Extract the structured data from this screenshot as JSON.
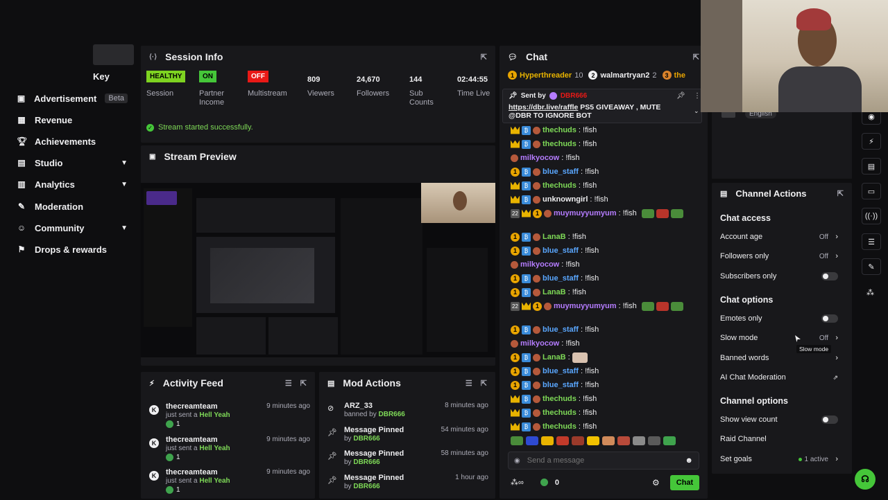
{
  "nav": {
    "items": [
      {
        "label": "Key",
        "icon": "key-icon"
      },
      {
        "label": "Advertisement",
        "icon": "ad-icon",
        "badge": "Beta"
      },
      {
        "label": "Revenue",
        "icon": "revenue-icon"
      },
      {
        "label": "Achievements",
        "icon": "trophy-icon"
      },
      {
        "label": "Studio",
        "icon": "studio-icon",
        "expandable": true
      },
      {
        "label": "Analytics",
        "icon": "analytics-icon",
        "expandable": true
      },
      {
        "label": "Moderation",
        "icon": "wrench-icon"
      },
      {
        "label": "Community",
        "icon": "community-icon",
        "expandable": true
      },
      {
        "label": "Drops & rewards",
        "icon": "drops-icon"
      }
    ]
  },
  "session": {
    "title": "Session Info",
    "stats": [
      {
        "value": "HEALTHY",
        "label": "Session",
        "badge_color": "#7ed321"
      },
      {
        "value": "ON",
        "label": "Partner Income",
        "badge_color": "#45c639"
      },
      {
        "value": "OFF",
        "label": "Multistream",
        "badge_color": "#e91916"
      },
      {
        "value": "809",
        "label": "Viewers"
      },
      {
        "value": "24,670",
        "label": "Followers"
      },
      {
        "value": "144",
        "label": "Sub Counts"
      },
      {
        "value": "02:44:55",
        "label": "Time Live"
      }
    ],
    "status": "Stream started successfully."
  },
  "preview": {
    "title": "Stream Preview"
  },
  "activity": {
    "title": "Activity Feed",
    "items": [
      {
        "name": "thecreamteam",
        "action": "just sent a",
        "item": "Hell Yeah",
        "time": "9 minutes ago",
        "count": "1"
      },
      {
        "name": "thecreamteam",
        "action": "just sent a",
        "item": "Hell Yeah",
        "time": "9 minutes ago",
        "count": "1"
      },
      {
        "name": "thecreamteam",
        "action": "just sent a",
        "item": "Hell Yeah",
        "time": "9 minutes ago",
        "count": "1"
      }
    ]
  },
  "mod": {
    "title": "Mod Actions",
    "items": [
      {
        "name": "ARZ_33",
        "action": "banned by",
        "by": "DBR666",
        "time": "8 minutes ago",
        "icon": "ban-icon"
      },
      {
        "name": "Message Pinned",
        "action": "by",
        "by": "DBR666",
        "time": "54 minutes ago",
        "icon": "pin-icon"
      },
      {
        "name": "Message Pinned",
        "action": "by",
        "by": "DBR666",
        "time": "58 minutes ago",
        "icon": "pin-icon"
      },
      {
        "name": "Message Pinned",
        "action": "by",
        "by": "DBR666",
        "time": "1 hour ago",
        "icon": "pin-icon"
      }
    ]
  },
  "chat": {
    "title": "Chat",
    "leaders": [
      {
        "name": "Hyperthreader",
        "count": "10"
      },
      {
        "name": "walmartryan2",
        "count": "2"
      },
      {
        "name": "the",
        "count": ""
      }
    ],
    "pinned": {
      "sent_by": "Sent by",
      "sender": "DBR666",
      "link": "https://dbr.live/raffle",
      "text": "PS5 GIVEAWAY , MUTE @DBR TO IGNORE BOT"
    },
    "messages": [
      {
        "user": "thechuds",
        "text": ": !fish",
        "color": "#7ed957"
      },
      {
        "user": "thechuds",
        "text": ": !fish",
        "color": "#7ed957"
      },
      {
        "user": "milkyocow",
        "text": ": !fish",
        "color": "#b57cff"
      },
      {
        "user": "blue_staff",
        "text": ": !fish",
        "color": "#5aa7ff"
      },
      {
        "user": "thechuds",
        "text": ": !fish",
        "color": "#7ed957"
      },
      {
        "user": "unknowngirl",
        "text": ": !fish",
        "color": "#efeff1"
      },
      {
        "user": "muymuyyumyum",
        "text": ": !fish",
        "color": "#b57cff"
      },
      {
        "user": "LanaB",
        "text": ": !fish",
        "color": "#7ed957"
      },
      {
        "user": "blue_staff",
        "text": ": !fish",
        "color": "#5aa7ff"
      },
      {
        "user": "milkyocow",
        "text": ": !fish",
        "color": "#b57cff"
      },
      {
        "user": "blue_staff",
        "text": ": !fish",
        "color": "#5aa7ff"
      },
      {
        "user": "LanaB",
        "text": ": !fish",
        "color": "#7ed957"
      },
      {
        "user": "muymuyyumyum",
        "text": ": !fish",
        "color": "#b57cff"
      },
      {
        "user": "blue_staff",
        "text": ": !fish",
        "color": "#5aa7ff"
      },
      {
        "user": "milkyocow",
        "text": ": !fish",
        "color": "#b57cff"
      },
      {
        "user": "LanaB",
        "text": ":",
        "color": "#7ed957"
      },
      {
        "user": "blue_staff",
        "text": ": !fish",
        "color": "#5aa7ff"
      },
      {
        "user": "blue_staff",
        "text": ": !fish",
        "color": "#5aa7ff"
      },
      {
        "user": "thechuds",
        "text": ": !fish",
        "color": "#7ed957"
      },
      {
        "user": "thechuds",
        "text": ": !fish",
        "color": "#7ed957"
      },
      {
        "user": "thechuds",
        "text": ": !fish",
        "color": "#7ed957"
      }
    ],
    "placeholder": "Send a message",
    "points": "0",
    "send_label": "Chat"
  },
  "channel_actions": {
    "language": "English",
    "title": "Channel Actions",
    "chat_access": "Chat access",
    "account_age": {
      "label": "Account age",
      "value": "Off"
    },
    "followers_only": {
      "label": "Followers only",
      "value": "Off"
    },
    "subscribers_only": {
      "label": "Subscribers only"
    },
    "chat_options": "Chat options",
    "emotes_only": {
      "label": "Emotes only"
    },
    "slow_mode": {
      "label": "Slow mode",
      "value": "Off",
      "tooltip": "Slow mode"
    },
    "banned_words": {
      "label": "Banned words"
    },
    "ai_moderation": {
      "label": "AI Chat Moderation"
    },
    "channel_options": "Channel options",
    "show_view_count": {
      "label": "Show view count"
    },
    "raid_channel": {
      "label": "Raid Channel"
    },
    "set_goals": {
      "label": "Set goals",
      "value": "1 active"
    }
  },
  "colors": {
    "accent": "#45c639",
    "panel": "#18181b",
    "bg": "#0e0e10"
  }
}
